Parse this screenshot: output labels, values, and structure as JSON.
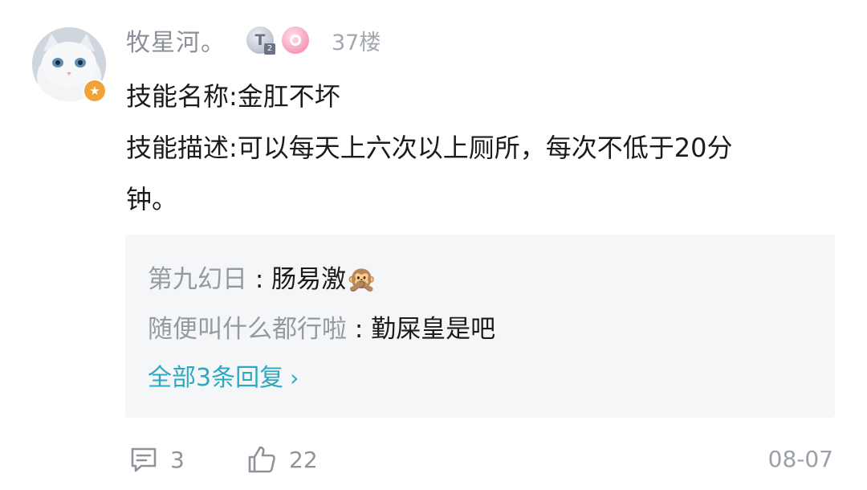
{
  "comment": {
    "username": "牧星河。",
    "floor": "37楼",
    "medals": [
      {
        "name": "titan-medal",
        "letter": "T",
        "sub": "2"
      },
      {
        "name": "fan-medal"
      }
    ],
    "lines": [
      "技能名称:金肛不坏",
      "技能描述:可以每天上六次以上厕所，每次不低于20分",
      "钟。"
    ],
    "replies": [
      {
        "author": "第九幻日",
        "separator": " : ",
        "text": "肠易激🙊"
      },
      {
        "author": "随便叫什么都行啦",
        "separator": " : ",
        "text": "勤屎皇是吧"
      }
    ],
    "view_all": "全部3条回复",
    "reply_count": "3",
    "like_count": "22",
    "date": "08-07"
  },
  "colors": {
    "accent": "#2aa9c2",
    "muted": "#8e939b",
    "reply_bg": "#f5f6f7",
    "vip_badge": "#f1a33a"
  }
}
